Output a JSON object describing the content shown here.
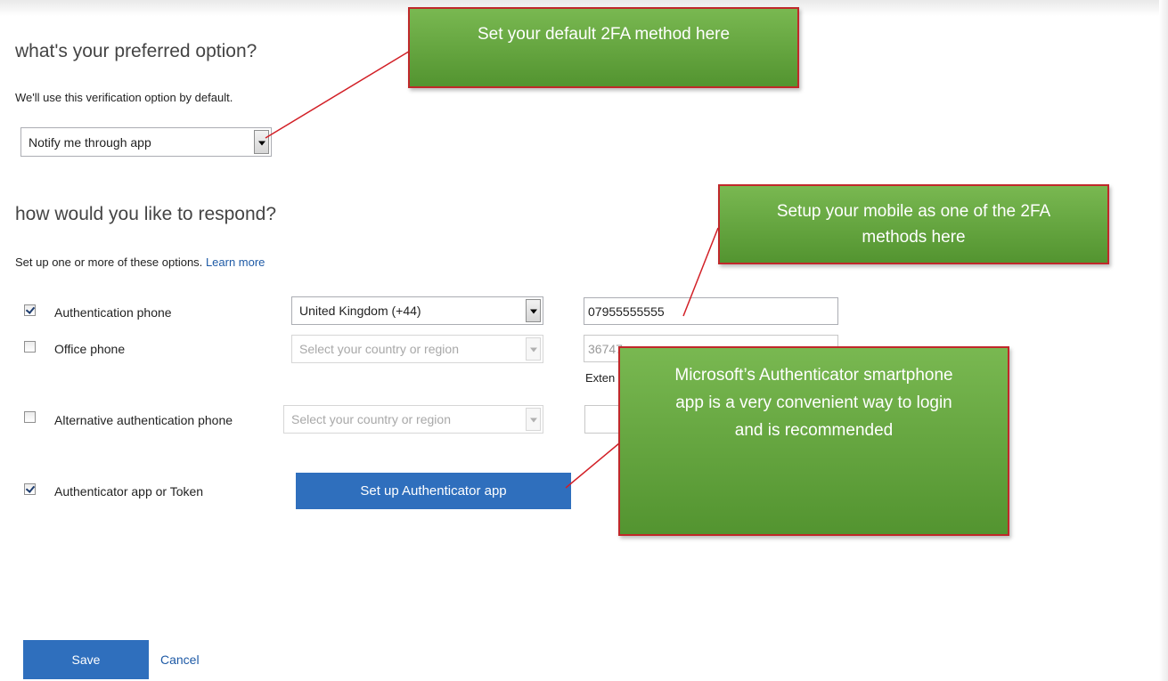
{
  "preferred": {
    "heading": "what's your preferred option?",
    "subtext": "We'll use this verification option by default.",
    "selected_option": "Notify me through app"
  },
  "respond": {
    "heading": "how would you like to respond?",
    "subtext": "Set up one or more of these options.",
    "learn_more": "Learn more"
  },
  "options": {
    "auth_phone": {
      "label": "Authentication phone",
      "checked": true,
      "country": "United Kingdom (+44)",
      "number": "07955555555"
    },
    "office_phone": {
      "label": "Office phone",
      "checked": false,
      "country_placeholder": "Select your country or region",
      "number": "36747",
      "extension_label": "Exten"
    },
    "alt_phone": {
      "label": "Alternative authentication phone",
      "checked": false,
      "country_placeholder": "Select your country or region"
    },
    "authenticator": {
      "label": "Authenticator app or Token",
      "checked": true,
      "button": "Set up Authenticator app"
    }
  },
  "actions": {
    "save": "Save",
    "cancel": "Cancel"
  },
  "callouts": {
    "default_method": "Set your default 2FA method here",
    "mobile": "Setup your mobile as one of the 2FA methods here",
    "authenticator": "Microsoft’s Authenticator smartphone app is a very convenient way to login and is recommended"
  },
  "colors": {
    "accent_blue": "#2f6fbd",
    "callout_green": "#65a840",
    "callout_border": "#c0282a",
    "link": "#1e5aa6"
  }
}
